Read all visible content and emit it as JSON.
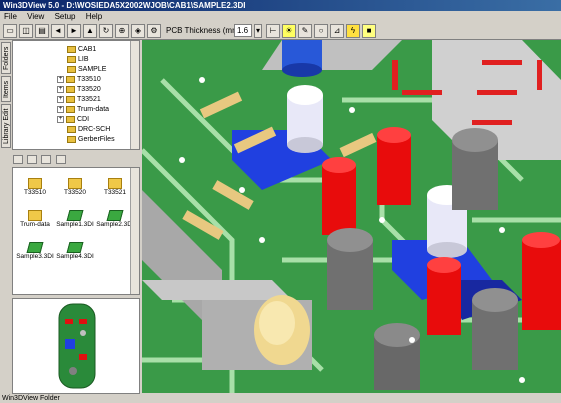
{
  "window": {
    "title": "Win3DView 5.0 - D:\\WOSIEDA5X2002WJOB\\CAB1\\SAMPLE2.3DI"
  },
  "menu": {
    "file": "File",
    "view": "View",
    "setup": "Setup",
    "help": "Help"
  },
  "toolbar": {
    "thickness_label": "PCB Thickness (mm)",
    "thickness_value": "1.6"
  },
  "side_tabs": {
    "folders": "Folders",
    "items": "Items",
    "library": "Library Edit"
  },
  "tree": {
    "items": [
      {
        "label": "CAB1",
        "expand": ""
      },
      {
        "label": "LIB",
        "expand": ""
      },
      {
        "label": "SAMPLE",
        "expand": ""
      },
      {
        "label": "T33510",
        "expand": "+"
      },
      {
        "label": "T33520",
        "expand": "+"
      },
      {
        "label": "T33521",
        "expand": "+"
      },
      {
        "label": "Trum-data",
        "expand": "+"
      },
      {
        "label": "CDI",
        "expand": "+"
      },
      {
        "label": "DRC-SCH",
        "expand": ""
      },
      {
        "label": "GerberFiles",
        "expand": ""
      }
    ]
  },
  "files": {
    "items": [
      {
        "label": "T33510",
        "kind": "folder"
      },
      {
        "label": "T33520",
        "kind": "folder"
      },
      {
        "label": "T33521",
        "kind": "folder"
      },
      {
        "label": "Trum-data",
        "kind": "folder"
      },
      {
        "label": "Sample1.3DI",
        "kind": "3di"
      },
      {
        "label": "Sample2.3DI",
        "kind": "3di"
      },
      {
        "label": "Sample3.3DI",
        "kind": "3di"
      },
      {
        "label": "Sample4.3DI",
        "kind": "3di"
      }
    ]
  },
  "status": {
    "text": "Win3DView Folder"
  },
  "colors": {
    "board": "#3a9a48",
    "trace": "#a8e0a8",
    "red_cap": "#e80c0c",
    "gray_cap": "#707070",
    "chip_blue": "#2040e0"
  }
}
